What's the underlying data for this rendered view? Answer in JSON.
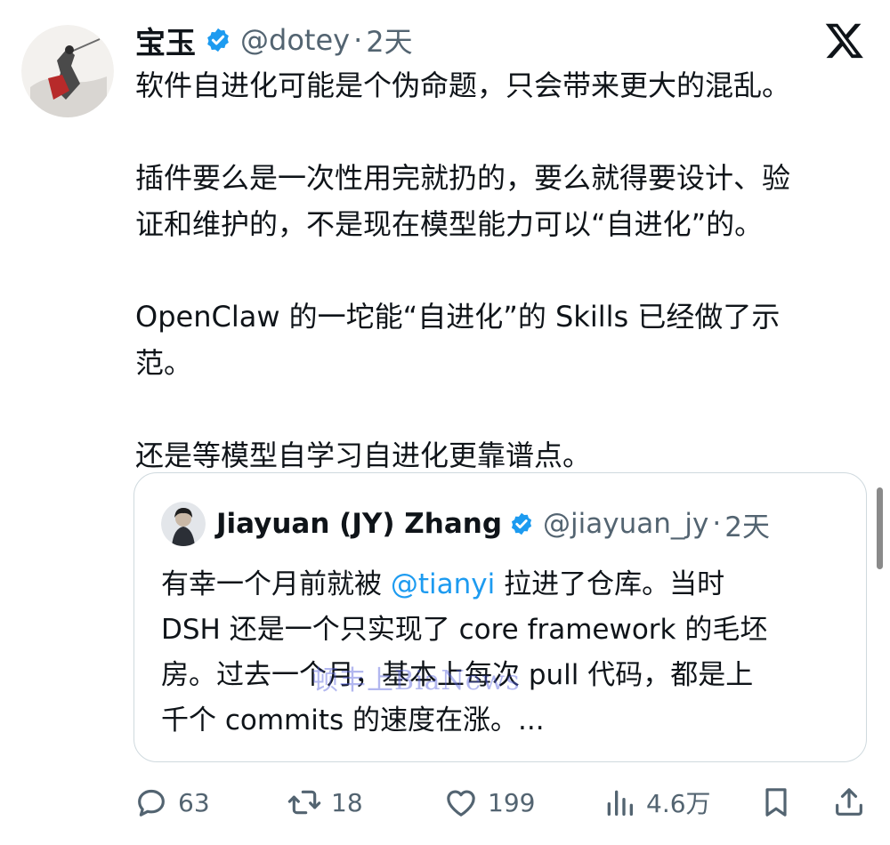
{
  "tweet": {
    "author": {
      "display_name": "宝玉",
      "handle": "@dotey",
      "separator": "·",
      "time": "2天",
      "verified": true
    },
    "paragraphs": [
      "软件自进化可能是个伪命题，只会带来更大的混乱。",
      "插件要么是一次性用完就扔的，要么就得要设计、验\n证和维护的，不是现在模型能力可以“自进化”的。",
      "OpenClaw 的一坨能“自进化”的 Skills 已经做了示\n范。",
      "还是等模型自学习自进化更靠谱点。"
    ]
  },
  "quote": {
    "author": {
      "display_name": "Jiayuan (JY) Zhang",
      "handle": "@jiayuan_jy",
      "separator": "·",
      "time": "2天",
      "verified": true
    },
    "text_before_mention": "有幸一个月前就被 ",
    "mention": "@tianyi",
    "text_after_mention": " 拉进了仓库。当时\nDSH 还是一个只实现了 core framework 的毛坯\n房。过去一个月，基本上每次 pull 代码，都是上\n千个 commits 的速度在涨。..."
  },
  "watermark": "顿丰上BiaNews",
  "actions": {
    "reply_count": "63",
    "retweet_count": "18",
    "like_count": "199",
    "view_count": "4.6万"
  },
  "icons": {
    "brand_logo": "x-logo-icon",
    "verified": "verified-badge-icon",
    "reply": "reply-icon",
    "retweet": "retweet-icon",
    "like": "heart-icon",
    "views": "views-icon",
    "bookmark": "bookmark-icon",
    "share": "share-icon"
  },
  "colors": {
    "text": "#0f1419",
    "secondary": "#536471",
    "link": "#1d9bf0",
    "verified": "#1d9bf0",
    "border": "#cfd9de"
  }
}
